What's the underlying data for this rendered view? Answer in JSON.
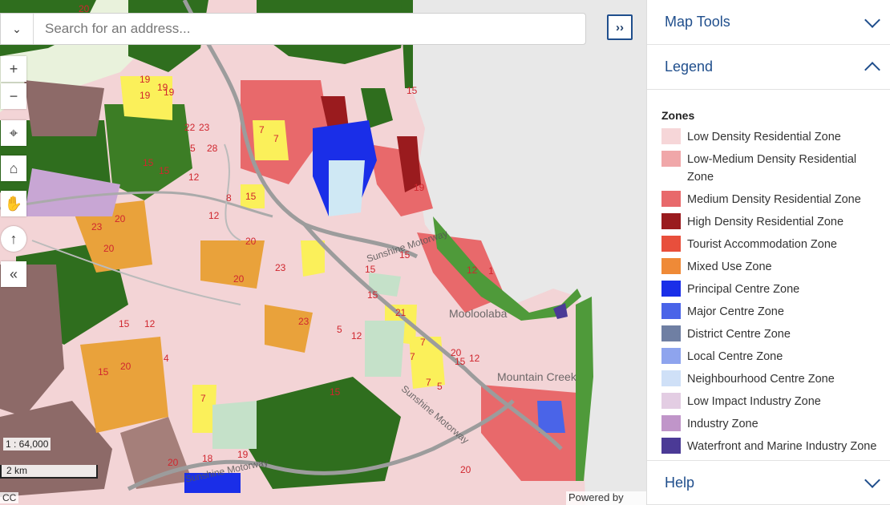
{
  "search": {
    "placeholder": "Search for an address..."
  },
  "map": {
    "scale": "1 : 64,000",
    "scale_bar": "2 km",
    "attribution_left": "CC",
    "attribution_right": "Powered by Esri",
    "roads": [
      "Sunshine Motorway",
      "Sunshine Motorway",
      "Sunshine Motorway"
    ],
    "places": [
      "Mooloolaba",
      "Mountain Creek"
    ],
    "zone_codes": [
      "20",
      "19",
      "19",
      "19",
      "19",
      "22",
      "23",
      "7",
      "7",
      "5",
      "28",
      "15",
      "15",
      "12",
      "8",
      "15",
      "20",
      "23",
      "23",
      "20",
      "15",
      "12",
      "20",
      "4",
      "15",
      "7",
      "15",
      "12",
      "20",
      "23",
      "15",
      "21",
      "7",
      "7",
      "15",
      "20",
      "20",
      "15",
      "15",
      "19",
      "19",
      "18",
      "20",
      "12",
      "5",
      "7",
      "20",
      "12",
      "1",
      "12",
      "15",
      "5"
    ]
  },
  "panel": {
    "map_tools": "Map Tools",
    "legend": "Legend",
    "legend_heading": "Zones",
    "help": "Help",
    "zones": [
      {
        "label": "Low Density Residential Zone",
        "color": "#f6d6d8"
      },
      {
        "label": "Low-Medium Density Residential Zone",
        "color": "#f0a7a9"
      },
      {
        "label": "Medium Density Residential Zone",
        "color": "#e8696b"
      },
      {
        "label": "High Density Residential Zone",
        "color": "#9a1b1e"
      },
      {
        "label": "Tourist Accommodation Zone",
        "color": "#e84f3c"
      },
      {
        "label": "Mixed Use Zone",
        "color": "#ef8a37"
      },
      {
        "label": "Principal Centre Zone",
        "color": "#1a2ee8"
      },
      {
        "label": "Major Centre Zone",
        "color": "#4a64e8"
      },
      {
        "label": "District Centre Zone",
        "color": "#6f7fa3"
      },
      {
        "label": "Local Centre Zone",
        "color": "#8ea4ee"
      },
      {
        "label": "Neighbourhood Centre Zone",
        "color": "#cfe0f7"
      },
      {
        "label": "Low Impact Industry Zone",
        "color": "#e3cde3"
      },
      {
        "label": "Industry Zone",
        "color": "#c095c9"
      },
      {
        "label": "Waterfront and Marine Industry Zone",
        "color": "#4b3a96"
      }
    ]
  }
}
